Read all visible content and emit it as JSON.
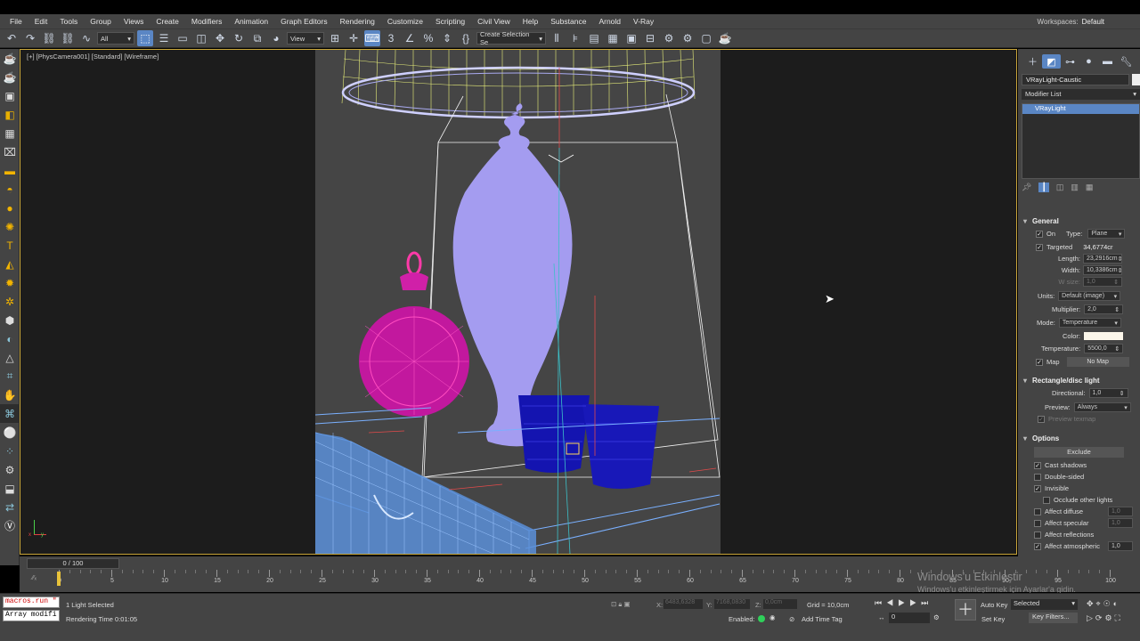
{
  "menu": [
    "File",
    "Edit",
    "Tools",
    "Group",
    "Views",
    "Create",
    "Modifiers",
    "Animation",
    "Graph Editors",
    "Rendering",
    "Customize",
    "Scripting",
    "Civil View",
    "Help",
    "Substance",
    "Arnold",
    "V-Ray"
  ],
  "workspace": {
    "label": "Workspaces:",
    "value": "Default"
  },
  "toolbar": {
    "filter_value": "All",
    "coord_value": "View",
    "selection_set_placeholder": "Create Selection Se"
  },
  "viewport": {
    "label": "[+] [PhysCamera001] [Standard] [Wireframe]",
    "axis_x": "x",
    "axis_y": "y"
  },
  "panel": {
    "object_name": "VRayLight-Caustic",
    "modifier_list": "Modifier List",
    "stack_item": "VRayLight",
    "general": {
      "title": "General",
      "on_label": "On",
      "type_label": "Type:",
      "type_value": "Plane",
      "targeted_label": "Targeted",
      "targeted_value": "34,6774cr",
      "length_label": "Length:",
      "length_value": "23,2916cm",
      "width_label": "Width:",
      "width_value": "10,3386cm",
      "wsize_label": "W size:",
      "wsize_value": "1,0",
      "units_label": "Units:",
      "units_value": "Default (image)",
      "multiplier_label": "Multiplier:",
      "multiplier_value": "2,0",
      "mode_label": "Mode:",
      "mode_value": "Temperature",
      "color_label": "Color:",
      "color_swatch": "#fbf6ea",
      "temperature_label": "Temperature:",
      "temperature_value": "5500,0",
      "map_label": "Map",
      "map_value": "No Map"
    },
    "rect": {
      "title": "Rectangle/disc light",
      "directional_label": "Directional:",
      "directional_value": "1,0",
      "preview_label": "Preview:",
      "preview_value": "Always",
      "preview_texmap": "Preview texmap"
    },
    "options": {
      "title": "Options",
      "exclude": "Exclude",
      "cast_shadows": "Cast shadows",
      "double_sided": "Double-sided",
      "invisible": "Invisible",
      "occlude": "Occlude other lights",
      "affect_diffuse": "Affect diffuse",
      "affect_diffuse_v": "1,0",
      "affect_specular": "Affect specular",
      "affect_specular_v": "1,0",
      "affect_reflections": "Affect reflections",
      "affect_atmospherics": "Affect atmospheric",
      "affect_atmospherics_v": "1,0"
    }
  },
  "timeline": {
    "slider_text": "0 / 100",
    "ticks": [
      "0",
      "5",
      "10",
      "15",
      "20",
      "25",
      "30",
      "35",
      "40",
      "45",
      "50",
      "55",
      "60",
      "65",
      "70",
      "75",
      "80",
      "85",
      "90",
      "95",
      "100"
    ]
  },
  "status": {
    "script1": "macros.run \"",
    "script2": "Array modifi",
    "selected": "1 Light Selected",
    "render_time": "Rendering Time  0:01:05",
    "x_label": "X:",
    "x_value": "6483,6328",
    "y_label": "Y:",
    "y_value": "7168,0830",
    "z_label": "Z:",
    "z_value": "0,0cm",
    "grid": "Grid = 10,0cm",
    "enabled": "Enabled:",
    "add_time_tag": "Add Time Tag",
    "auto_key": "Auto Key",
    "set_key": "Set Key",
    "selected_dd": "Selected",
    "key_filters": "Key Filters...",
    "frame_value": "0"
  },
  "watermark": {
    "line1": "Windows'u Etkinleştir",
    "line2": "Windows'u etkinleştirmek için Ayarlar'a gidin."
  }
}
